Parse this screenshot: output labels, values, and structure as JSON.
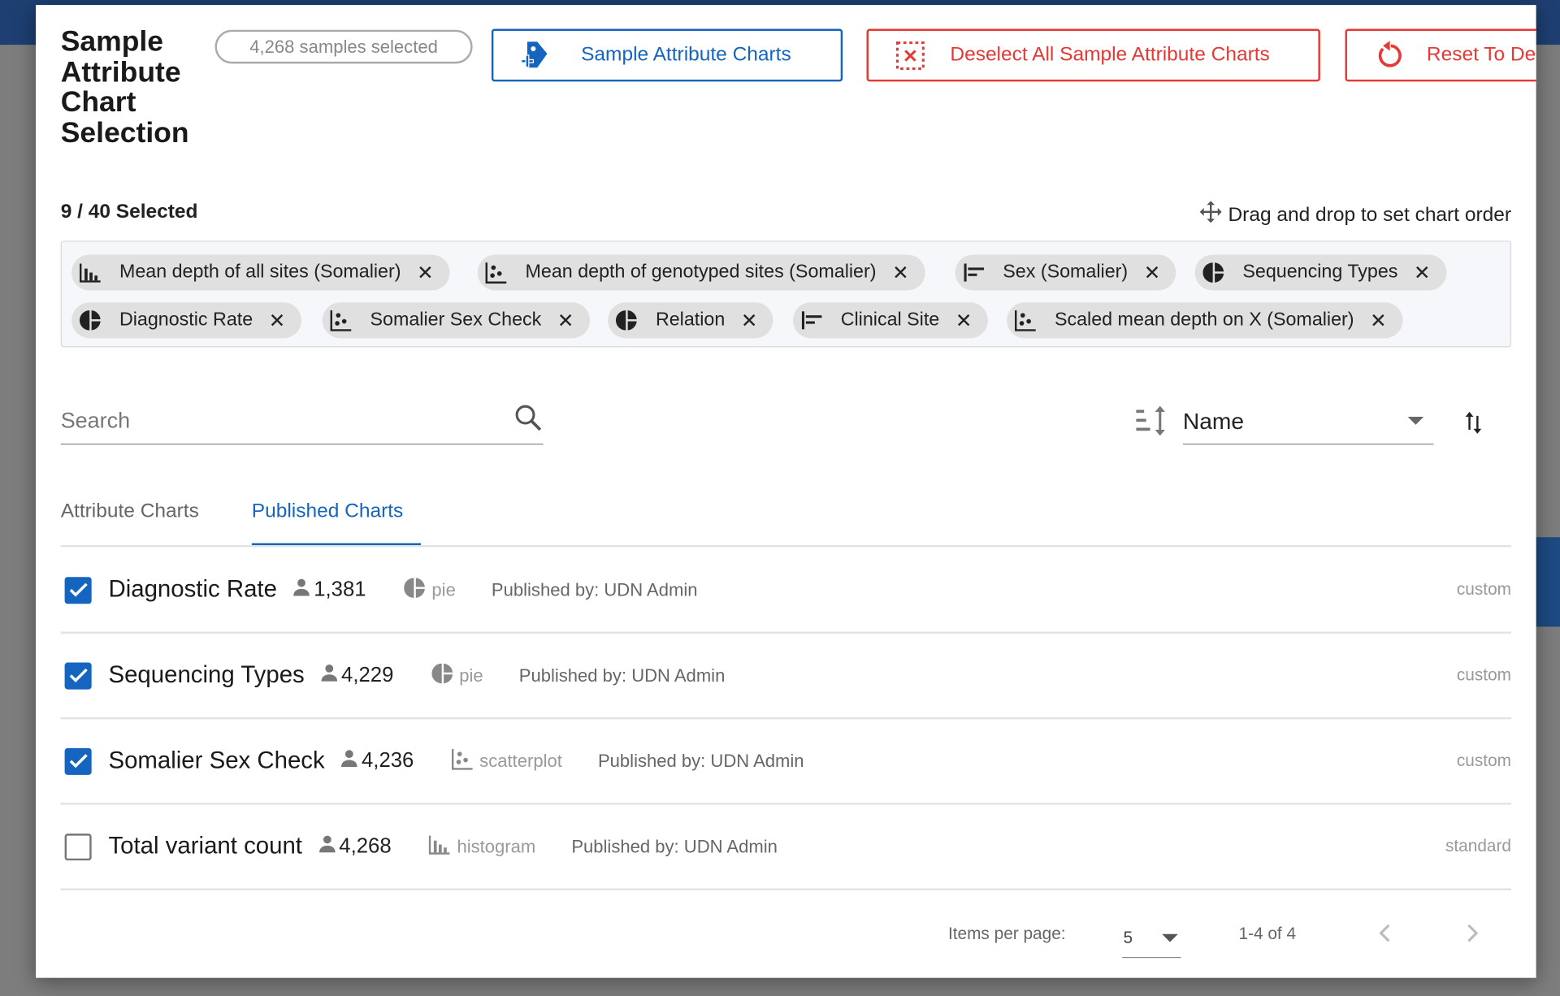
{
  "dialog": {
    "title": "Sample Attribute Chart Selection",
    "samples_badge": "4,268 samples selected",
    "buttons": {
      "sample_attribute_charts": "Sample Attribute Charts",
      "deselect_all": "Deselect All Sample Attribute Charts",
      "reset": "Reset To De"
    },
    "selected_count": "9 / 40 Selected",
    "drag_hint": "Drag and drop to set chart order",
    "chips": [
      {
        "label": "Mean depth of all sites (Somalier)",
        "icon": "histogram-icon"
      },
      {
        "label": "Mean depth of genotyped sites (Somalier)",
        "icon": "scatterplot-icon"
      },
      {
        "label": "Sex (Somalier)",
        "icon": "bar-chart-icon"
      },
      {
        "label": "Sequencing Types",
        "icon": "pie-chart-icon"
      },
      {
        "label": "Diagnostic Rate",
        "icon": "pie-chart-icon"
      },
      {
        "label": "Somalier Sex Check",
        "icon": "scatterplot-icon"
      },
      {
        "label": "Relation",
        "icon": "pie-chart-icon"
      },
      {
        "label": "Clinical Site",
        "icon": "bar-chart-icon"
      },
      {
        "label": "Scaled mean depth on X (Somalier)",
        "icon": "scatterplot-icon"
      }
    ],
    "search": {
      "placeholder": "Search"
    },
    "sort": {
      "value": "Name"
    },
    "tabs": [
      {
        "label": "Attribute Charts",
        "active": false
      },
      {
        "label": "Published Charts",
        "active": true
      }
    ],
    "rows": [
      {
        "name": "Diagnostic Rate",
        "count": "1,381",
        "type": "pie",
        "published": "Published by: UDN Admin",
        "tag": "custom",
        "checked": true
      },
      {
        "name": "Sequencing Types",
        "count": "4,229",
        "type": "pie",
        "published": "Published by: UDN Admin",
        "tag": "custom",
        "checked": true
      },
      {
        "name": "Somalier Sex Check",
        "count": "4,236",
        "type": "scatterplot",
        "published": "Published by: UDN Admin",
        "tag": "custom",
        "checked": true
      },
      {
        "name": "Total variant count",
        "count": "4,268",
        "type": "histogram",
        "published": "Published by: UDN Admin",
        "tag": "standard",
        "checked": false
      }
    ],
    "paginator": {
      "items_per_page_label": "Items per page:",
      "page_size": "5",
      "range": "1-4 of 4"
    },
    "colors": {
      "primary": "#1565c0",
      "danger": "#e53935"
    }
  }
}
